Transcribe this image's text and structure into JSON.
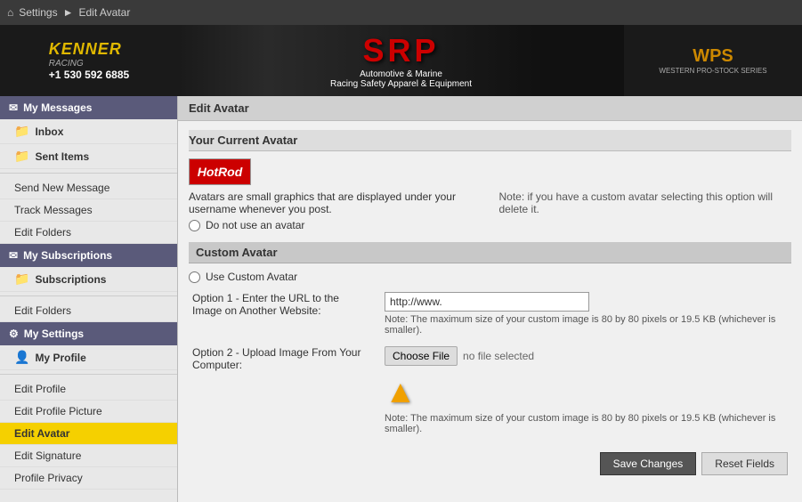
{
  "topbar": {
    "home_icon": "⌂",
    "breadcrumb_settings": "Settings",
    "breadcrumb_sep": "►",
    "breadcrumb_current": "Edit Avatar"
  },
  "banner": {
    "kenner_name": "KENNER",
    "kenner_sub": "RACING",
    "kenner_phone": "+1 530 592 6885",
    "srp_text": "SRP",
    "srp_line1": "Automotive & Marine",
    "srp_line2": "Racing Safety Apparel & Equipment",
    "wps_text": "WPS",
    "wps_sub": "WESTERN PRO-STOCK SERIES"
  },
  "sidebar": {
    "my_messages_header": "My Messages",
    "inbox_label": "Inbox",
    "sent_items_label": "Sent Items",
    "send_new_message_label": "Send New Message",
    "track_messages_label": "Track Messages",
    "edit_folders_messages_label": "Edit Folders",
    "my_subscriptions_header": "My Subscriptions",
    "subscriptions_label": "Subscriptions",
    "edit_folders_subs_label": "Edit Folders",
    "my_settings_header": "My Settings",
    "my_profile_label": "My Profile",
    "edit_profile_label": "Edit Profile",
    "edit_profile_picture_label": "Edit Profile Picture",
    "edit_avatar_label": "Edit Avatar",
    "edit_signature_label": "Edit Signature",
    "profile_privacy_label": "Profile Privacy"
  },
  "content": {
    "header": "Edit Avatar",
    "your_current_avatar_label": "Your Current Avatar",
    "avatar_description": "Avatars are small graphics that are displayed under your username whenever you post.",
    "do_not_use_label": "Do not use an avatar",
    "note_custom_delete": "Note: if you have a custom avatar selecting this option will delete it.",
    "custom_avatar_label": "Custom Avatar",
    "use_custom_avatar_label": "Use Custom Avatar",
    "option1_label": "Option 1 - Enter the URL to the Image on Another Website:",
    "option1_url_value": "http://www.",
    "option1_note": "Note: The maximum size of your custom image is 80 by 80 pixels or 19.5 KB (whichever is smaller).",
    "option2_label": "Option 2 - Upload Image From Your Computer:",
    "choose_file_label": "Choose File",
    "no_file_selected": "no file selected",
    "option2_note": "Note: The maximum size of your custom image is 80 by 80 pixels or 19.5 KB (whichever is smaller).",
    "save_changes_label": "Save Changes",
    "reset_fields_label": "Reset Fields"
  }
}
